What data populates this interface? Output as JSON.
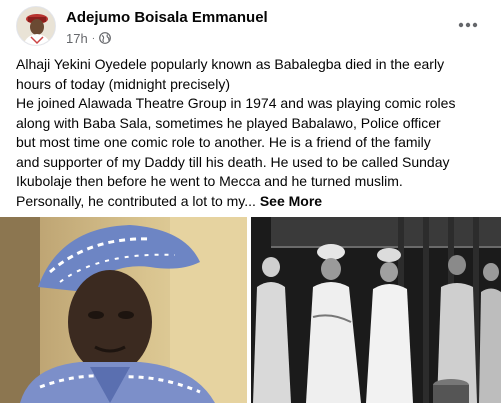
{
  "post": {
    "author": "Adejumo Boisala Emmanuel",
    "time": "17h",
    "separator": "·",
    "privacy_icon": "globe-icon",
    "more_icon": "more-options-icon",
    "lines": [
      "Alhaji Yekini Oyedele popularly known as Babalegba died in the early",
      "hours of today (midnight precisely)",
      "He joined Alawada Theatre Group in 1974 and was playing comic roles",
      "along with Baba Sala, sometimes he played Babalawo, Police officer",
      "but most time one comic role to another. He is a friend of the family",
      "and supporter of my Daddy till his death. He used to be called Sunday",
      "Ikubolaje then before he went to Mecca and he turned muslim.",
      "Personally, he contributed a lot to my..."
    ],
    "see_more": "See More"
  },
  "colors": {
    "text": "#050505",
    "secondary": "#65676b"
  }
}
